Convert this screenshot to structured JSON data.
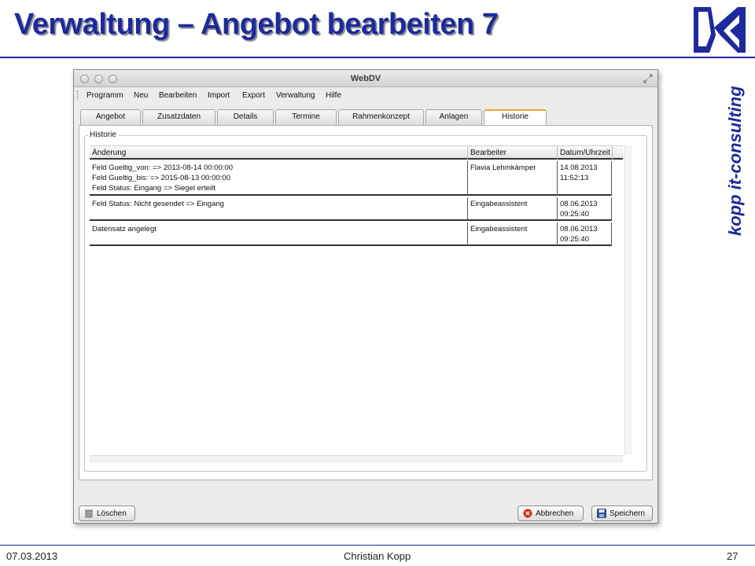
{
  "slide": {
    "title": "Verwaltung – Angebot bearbeiten 7",
    "brand": "kopp it-consulting",
    "footer": {
      "date": "07.03.2013",
      "author": "Christian Kopp",
      "page": "27"
    },
    "colors": {
      "brand": "#1d2a9c",
      "tab_accent": "#f0a33a"
    }
  },
  "window": {
    "title": "WebDV",
    "menu": [
      "Programm",
      "Neu",
      "Bearbeiten",
      "Import",
      "Export",
      "Verwaltung",
      "Hilfe"
    ],
    "tabs": [
      "Angebot",
      "Zusatzdaten",
      "Details",
      "Termine",
      "Rahmenkonzept",
      "Anlagen",
      "Historie"
    ],
    "active_tab": "Historie",
    "group_label": "Historie",
    "table": {
      "columns": [
        "Änderung",
        "Bearbeiter",
        "Datum/Uhrzeit"
      ],
      "rows": [
        {
          "change": "Feld Gueltig_von: => 2013-08-14 00:00:00\nFeld Gueltig_bis: => 2015-08-13 00:00:00\nFeld Status: Eingang => Siegel erteilt",
          "editor": "Flavia Lehmkämper",
          "datetime": "14.08.2013\n11:52:13"
        },
        {
          "change": "Feld Status: Nicht gesendet => Eingang",
          "editor": "Eingabeassistent",
          "datetime": "08.06.2013\n09:25:40"
        },
        {
          "change": "Datensatz angelegt",
          "editor": "Eingabeassistent",
          "datetime": "08.06.2013\n09:25:40"
        }
      ]
    },
    "buttons": {
      "delete": "Löschen",
      "cancel": "Abbrechen",
      "save": "Speichern"
    }
  }
}
